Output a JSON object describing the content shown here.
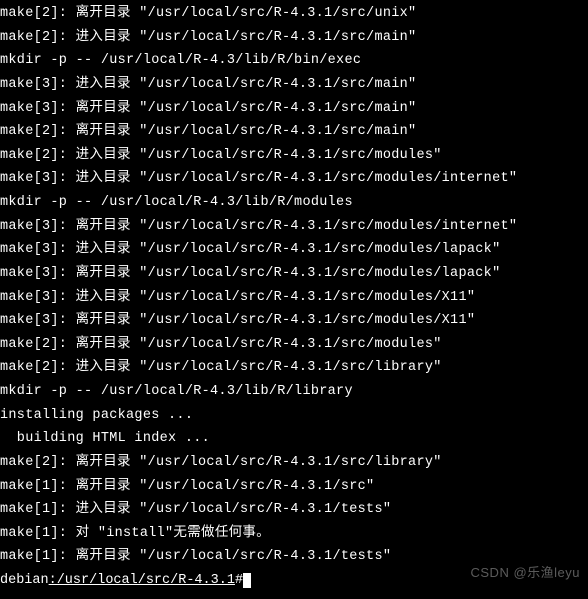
{
  "lines": [
    "make[2]: 离开目录 \"/usr/local/src/R-4.3.1/src/unix\"",
    "make[2]: 进入目录 \"/usr/local/src/R-4.3.1/src/main\"",
    "mkdir -p -- /usr/local/R-4.3/lib/R/bin/exec",
    "make[3]: 进入目录 \"/usr/local/src/R-4.3.1/src/main\"",
    "make[3]: 离开目录 \"/usr/local/src/R-4.3.1/src/main\"",
    "make[2]: 离开目录 \"/usr/local/src/R-4.3.1/src/main\"",
    "make[2]: 进入目录 \"/usr/local/src/R-4.3.1/src/modules\"",
    "make[3]: 进入目录 \"/usr/local/src/R-4.3.1/src/modules/internet\"",
    "mkdir -p -- /usr/local/R-4.3/lib/R/modules",
    "make[3]: 离开目录 \"/usr/local/src/R-4.3.1/src/modules/internet\"",
    "make[3]: 进入目录 \"/usr/local/src/R-4.3.1/src/modules/lapack\"",
    "make[3]: 离开目录 \"/usr/local/src/R-4.3.1/src/modules/lapack\"",
    "make[3]: 进入目录 \"/usr/local/src/R-4.3.1/src/modules/X11\"",
    "make[3]: 离开目录 \"/usr/local/src/R-4.3.1/src/modules/X11\"",
    "make[2]: 离开目录 \"/usr/local/src/R-4.3.1/src/modules\"",
    "make[2]: 进入目录 \"/usr/local/src/R-4.3.1/src/library\"",
    "mkdir -p -- /usr/local/R-4.3/lib/R/library",
    "installing packages ...",
    "  building HTML index ...",
    "make[2]: 离开目录 \"/usr/local/src/R-4.3.1/src/library\"",
    "make[1]: 离开目录 \"/usr/local/src/R-4.3.1/src\"",
    "make[1]: 进入目录 \"/usr/local/src/R-4.3.1/tests\"",
    "make[1]: 对 \"install\"无需做任何事。",
    "make[1]: 离开目录 \"/usr/local/src/R-4.3.1/tests\""
  ],
  "prompt": {
    "host": "debian",
    "path": ":/usr/local/src/R-4.3.1",
    "suffix": "#"
  },
  "watermark": "CSDN @乐渔leyu"
}
